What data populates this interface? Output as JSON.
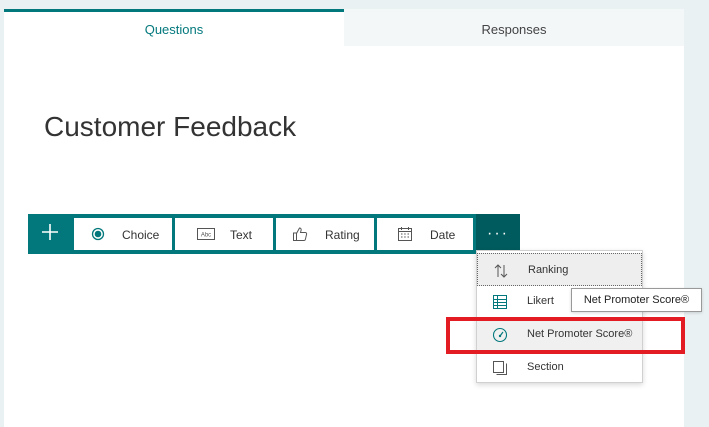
{
  "tabs": [
    {
      "label": "Questions",
      "active": true
    },
    {
      "label": "Responses",
      "active": false
    }
  ],
  "form": {
    "title": "Customer Feedback"
  },
  "toolbar": {
    "add_icon": "plus-icon",
    "buttons": [
      {
        "label": "Choice",
        "icon": "radio-icon"
      },
      {
        "label": "Text",
        "icon": "text-icon"
      },
      {
        "label": "Rating",
        "icon": "thumbs-up-icon"
      },
      {
        "label": "Date",
        "icon": "calendar-icon"
      }
    ],
    "more_label": "···"
  },
  "menu": {
    "items": [
      {
        "label": "Ranking",
        "icon": "sort-arrows-icon"
      },
      {
        "label": "Likert",
        "icon": "grid-icon"
      },
      {
        "label": "Net Promoter Score®",
        "icon": "gauge-icon"
      },
      {
        "label": "Section",
        "icon": "section-icon"
      }
    ]
  },
  "tooltip": {
    "text": "Net Promoter Score®"
  },
  "colors": {
    "accent": "#03787c",
    "accent_dark": "#005b5e",
    "highlight": "#e31b23"
  }
}
